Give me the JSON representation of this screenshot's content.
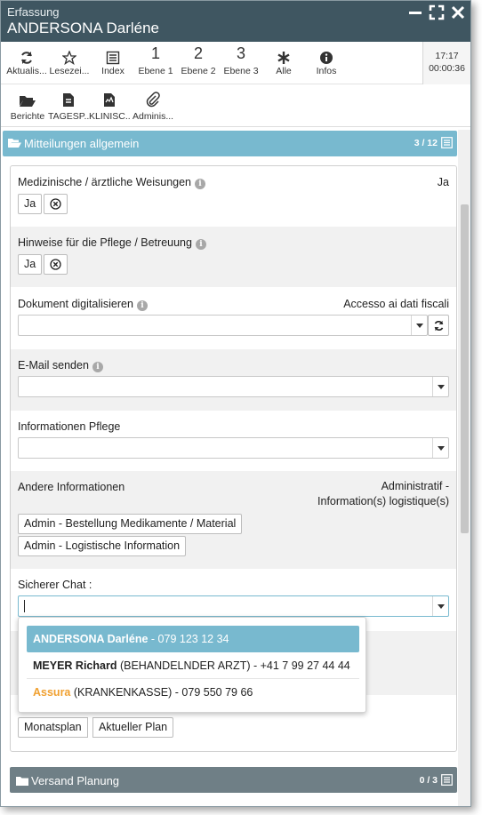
{
  "window": {
    "subtitle": "Erfassung",
    "title": "ANDERSONA Darléne"
  },
  "toolbar": {
    "items": [
      {
        "label": "Aktualis...",
        "icon": "refresh-icon"
      },
      {
        "label": "Lesezei...",
        "icon": "star-icon"
      },
      {
        "label": "Index",
        "icon": "list-icon"
      },
      {
        "label": "Ebene 1",
        "number": "1"
      },
      {
        "label": "Ebene 2",
        "number": "2"
      },
      {
        "label": "Ebene 3",
        "number": "3"
      },
      {
        "label": "Alle",
        "icon": "asterisk-icon"
      },
      {
        "label": "Infos",
        "icon": "info-icon"
      }
    ],
    "time": "17:17",
    "timer": "00:00:36"
  },
  "toolbar2": {
    "items": [
      {
        "label": "Berichte",
        "icon": "folder-open-icon"
      },
      {
        "label": "TAGESP...",
        "icon": "document-icon"
      },
      {
        "label": "KLINISC...",
        "icon": "document-chart-icon"
      },
      {
        "label": "Adminis...",
        "icon": "paperclip-icon"
      }
    ]
  },
  "section": {
    "title": "Mitteilungen allgemein",
    "count": "3 / 12",
    "color": "#78b9cf"
  },
  "fields": {
    "weisungen": {
      "label": "Medizinische / ärztliche Weisungen",
      "value": "Ja",
      "button": "Ja"
    },
    "hinweise": {
      "label": "Hinweise für die Pflege / Betreuung",
      "button": "Ja"
    },
    "dokument": {
      "label": "Dokument digitalisieren",
      "value": "Accesso ai dati fiscali",
      "selected": ""
    },
    "email": {
      "label": "E-Mail senden",
      "selected": ""
    },
    "infopflege": {
      "label": "Informationen Pflege",
      "selected": ""
    },
    "andere": {
      "label": "Andere Informationen",
      "value_line1": "Administratif -",
      "value_line2": "Information(s) logistique(s)",
      "tags": [
        "Admin - Bestellung Medikamente / Material",
        "Admin - Logistische Information"
      ]
    },
    "chat": {
      "label": "Sicherer Chat :",
      "input_value": ""
    },
    "plan": {
      "buttons": [
        "Monatsplan",
        "Aktueller Plan"
      ]
    }
  },
  "dropdown": {
    "options": [
      {
        "name": "ANDERSONA Darléne",
        "detail": " - 079 123 12 34",
        "selected": true
      },
      {
        "name": "MEYER Richard",
        "detail": " (BEHANDELNDER ARZT) - +41 7 99 27 44 44"
      },
      {
        "name": "Assura",
        "detail": " (KRANKENKASSE) - 079 550 79 66",
        "accent": "#f0a030"
      }
    ]
  },
  "footer_section": {
    "title": "Versand Planung",
    "count": "0 / 3",
    "color": "#6f7f86"
  }
}
